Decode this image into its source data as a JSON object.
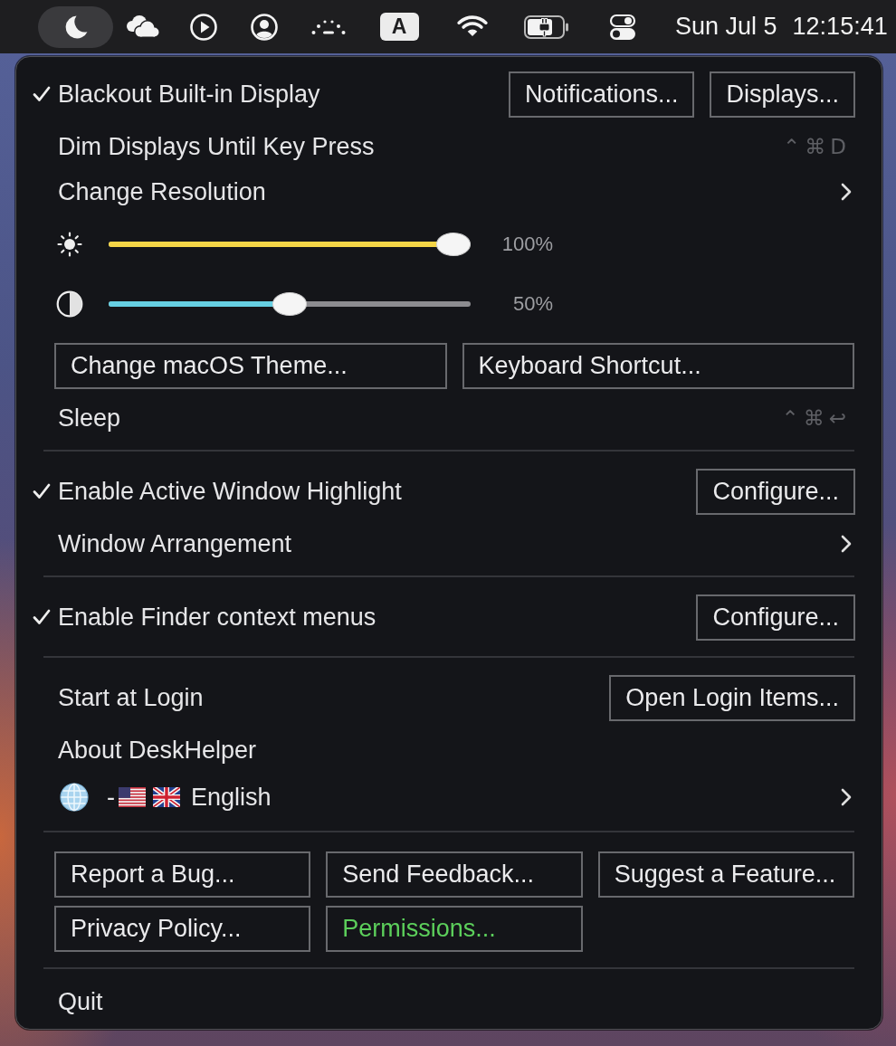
{
  "menu_bar": {
    "status_items": [
      {
        "kind": "icon",
        "selected": true
      },
      {
        "kind": "icon",
        "selected": false
      },
      {
        "kind": "icon",
        "selected": false
      },
      {
        "kind": "icon",
        "selected": false
      },
      {
        "kind": "icon",
        "selected": false
      },
      {
        "kind": "badge",
        "label": "A",
        "selected": false
      },
      {
        "kind": "icon",
        "selected": false
      },
      {
        "kind": "icon",
        "selected": false
      },
      {
        "kind": "icon",
        "selected": false
      }
    ],
    "date": "Sun Jul 5",
    "time": "12:15:41"
  },
  "menu": {
    "sections": [
      {
        "rows": [
          {
            "kind": "toggle",
            "label": "Blackout Built-in Display",
            "checked": true,
            "buttons": [
              {
                "label": "Notifications..."
              },
              {
                "label": "Displays..."
              }
            ]
          },
          {
            "kind": "item",
            "label": "Dim Displays Until Key Press",
            "shortcut": "⌃⌘D"
          },
          {
            "kind": "submenu",
            "label": "Change Resolution"
          },
          {
            "kind": "slider",
            "level": 1,
            "color": "#f5d547",
            "reading": "100%"
          },
          {
            "kind": "slider",
            "level": 0.5,
            "color": "#66cfe2",
            "reading": "50%"
          },
          {
            "kind": "buttons",
            "buttons": [
              {
                "label": "Change macOS Theme..."
              },
              {
                "label": "Keyboard Shortcut..."
              }
            ]
          },
          {
            "kind": "item",
            "label": "Sleep",
            "shortcut": "⌃⌘↩"
          }
        ]
      },
      {
        "rows": [
          {
            "kind": "toggle",
            "label": "Enable Active Window Highlight",
            "checked": true,
            "buttons": [
              {
                "label": "Configure..."
              }
            ]
          },
          {
            "kind": "submenu",
            "label": "Window Arrangement"
          }
        ]
      },
      {
        "rows": [
          {
            "kind": "toggle",
            "label": "Enable Finder context menus",
            "checked": true,
            "buttons": [
              {
                "label": "Configure..."
              }
            ]
          }
        ]
      },
      {
        "rows": [
          {
            "kind": "toggle",
            "label": "Start at Login",
            "checked": false,
            "buttons": [
              {
                "label": "Open Login Items..."
              }
            ]
          },
          {
            "kind": "item",
            "label": "About DeskHelper"
          },
          {
            "kind": "language",
            "separator": "-",
            "label": "English"
          }
        ]
      },
      {
        "rows": [
          {
            "kind": "buttons",
            "buttons": [
              {
                "label": "Report a Bug..."
              },
              {
                "label": "Send Feedback..."
              },
              {
                "label": "Suggest a Feature..."
              },
              {
                "label": "Privacy Policy..."
              },
              {
                "label": "Permissions...",
                "color": "#5ccf5b"
              }
            ]
          }
        ]
      },
      {
        "rows": [
          {
            "kind": "item",
            "label": "Quit"
          }
        ]
      }
    ]
  }
}
